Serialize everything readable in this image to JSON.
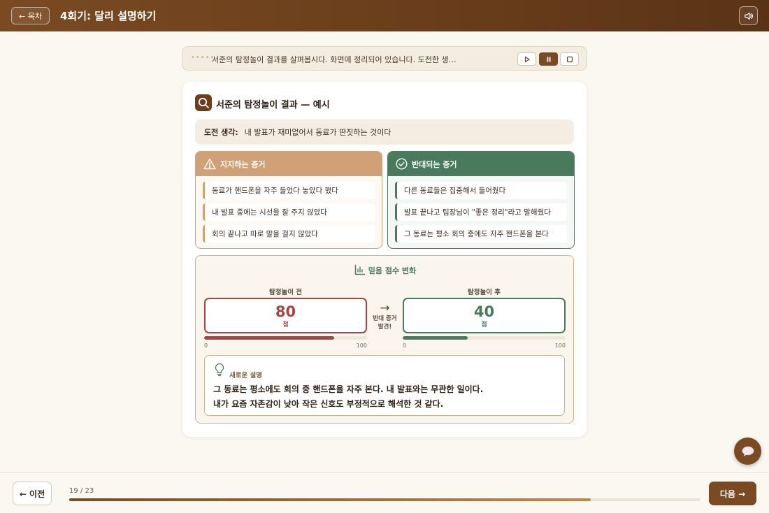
{
  "header": {
    "toc_label": "← 목차",
    "title": "4회기: 달리 설명하기",
    "sound_icon": "speaker-icon"
  },
  "narration": {
    "dots": "•••••",
    "text": "서준의 탐정놀이 결과를 살펴봅시다. 화면에 정리되어 있습니다. 도전한 생…",
    "controls": [
      "play-icon",
      "pause-icon",
      "stop-icon"
    ],
    "active_control": "pause-icon"
  },
  "card": {
    "title": "서준의 탐정놀이 결과 — 예시",
    "thought": {
      "label": "도전 생각:",
      "value": "내 발표가 재미없어서 동료가 딴짓하는 것이다"
    },
    "support": {
      "heading": "지지하는 증거",
      "items": [
        "동료가 핸드폰을 자주 들었다 놓았다 했다",
        "내 발표 중에는 시선을 잘 주지 않았다",
        "회의 끝나고 따로 말을 걸지 않았다"
      ]
    },
    "against": {
      "heading": "반대되는 증거",
      "items": [
        "다른 동료들은 집중해서 들어줬다",
        "발표 끝나고 팀장님이 \"좋은 정리\"라고 말해줬다",
        "그 동료는 평소 회의 중에도 자주 핸드폰을 본다"
      ]
    },
    "score": {
      "title": "믿음 점수 변화",
      "before_label": "탐정놀이 전",
      "before_value": "80",
      "before_fraction": 0.8,
      "after_label": "탐정놀이 후",
      "after_value": "40",
      "after_fraction": 0.4,
      "unit": "점",
      "arrow": "→",
      "arrow_label_1": "반대 증거",
      "arrow_label_2": "발견!",
      "min": "0",
      "max": "100",
      "before_color": "#a84444",
      "after_color": "#4a7a5c"
    },
    "explanation": {
      "label": "새로운 설명",
      "line1": "그 동료는 평소에도 회의 중 핸드폰을 자주 본다. 내 발표와는 무관한 일이다.",
      "line2": "내가 요즘 자존감이 낮아 작은 신호도 부정적으로 해석한 것 같다."
    }
  },
  "footer": {
    "prev_label": "← 이전",
    "progress_text": "19 / 23",
    "progress_fraction": 0.826,
    "next_label": "다음 →"
  },
  "colors": {
    "brand": "#7a4a22",
    "support": "#d0a077",
    "against": "#4a7a5c"
  }
}
